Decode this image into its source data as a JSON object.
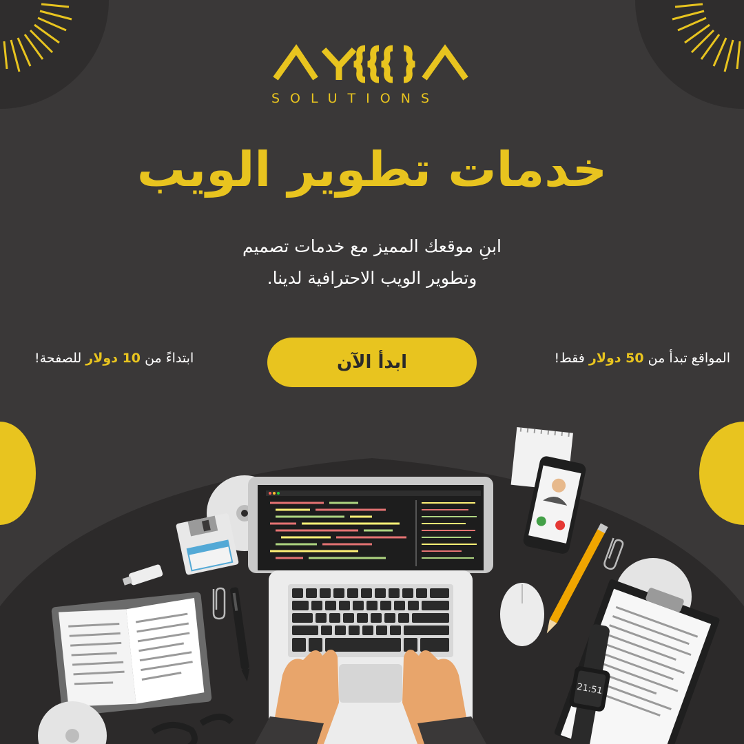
{
  "brand": {
    "logo_text": "AY}}}A",
    "sub": "SOLUTIONS"
  },
  "headline": "خدمات تطوير الويب",
  "subtitle": {
    "line1": "ابنِ موقعك المميز مع خدمات تصميم",
    "line2": "وتطوير الويب الاحترافية لدينا."
  },
  "cta": {
    "label": "ابدأ الآن"
  },
  "pricing": {
    "sites": {
      "prefix": "المواقع تبدأ من",
      "amount": "50 دولار",
      "suffix": "فقط!"
    },
    "pages": {
      "prefix": "ابتداءً من",
      "amount": "10 دولار",
      "suffix": "للصفحة!"
    }
  },
  "phone": {
    "clock": ""
  },
  "watch": {
    "time": "21:51"
  },
  "colors": {
    "background": "#3a3838",
    "accent": "#e8c41f",
    "text": "#ffffff",
    "button_text": "#2a2a2a"
  },
  "icons": [
    "sunburst-decoration",
    "floppy-disk-icon",
    "cd-icon",
    "usb-drive-icon",
    "notepad-icon",
    "smartphone-icon",
    "pencil-icon",
    "paperclip-icon",
    "mouse-icon",
    "clipboard-icon",
    "smartwatch-icon",
    "book-icon",
    "glasses-icon",
    "pen-icon",
    "laptop-icon"
  ]
}
